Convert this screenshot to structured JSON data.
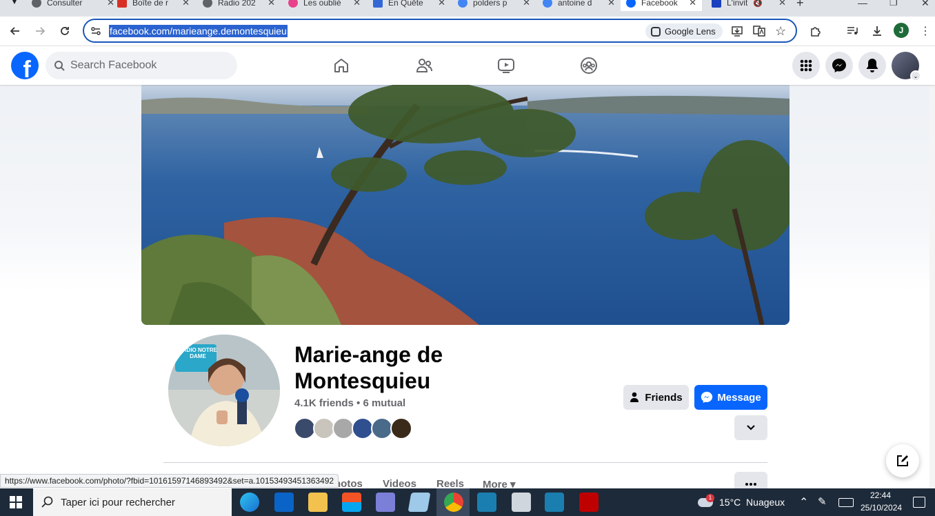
{
  "browser": {
    "tabs": [
      {
        "title": "Consulter",
        "color": "#5f6368"
      },
      {
        "title": "Boîte de r",
        "color": "#d93025"
      },
      {
        "title": "Radio 202",
        "color": "#5f6368"
      },
      {
        "title": "Les oublié",
        "color": "#e8438a"
      },
      {
        "title": "En Quête",
        "color": "#3367d6"
      },
      {
        "title": "polders p",
        "color": "#4285f4"
      },
      {
        "title": "antoine d",
        "color": "#4285f4"
      },
      {
        "title": "Facebook",
        "color": "#0866ff"
      },
      {
        "title": "L'invit",
        "color": "#1a3fbf"
      }
    ],
    "url": "facebook.com/marieange.demontesquieu",
    "lens_label": "Google Lens",
    "profile_initial": "J"
  },
  "facebook": {
    "logo": "f",
    "search_placeholder": "Search Facebook"
  },
  "profile": {
    "name": "Marie-ange de Montesquieu",
    "friends_summary": "4.1K friends • 6 mutual",
    "friends_button": "Friends",
    "message_button": "Message",
    "avatar_text": "RADIO NOTRE DAME",
    "tabs": [
      "Photos",
      "Videos",
      "Reels",
      "More ▾"
    ],
    "mutual_colors": [
      "#3a4a6a",
      "#c9c5bd",
      "#a8a8a8",
      "#2f4f8f",
      "#4a6a8a",
      "#3a2a1a"
    ]
  },
  "status_url": "https://www.facebook.com/photo/?fbid=10161597146893492&set=a.10153493451363492",
  "taskbar": {
    "search_placeholder": "Taper ici pour rechercher",
    "weather": "15°C  Nuageux",
    "time": "22:44",
    "date": "25/10/2024",
    "weather_badge": "1"
  },
  "colors": {
    "facebook_blue": "#0866ff",
    "taskbar_bg": "#1d2a3a"
  }
}
